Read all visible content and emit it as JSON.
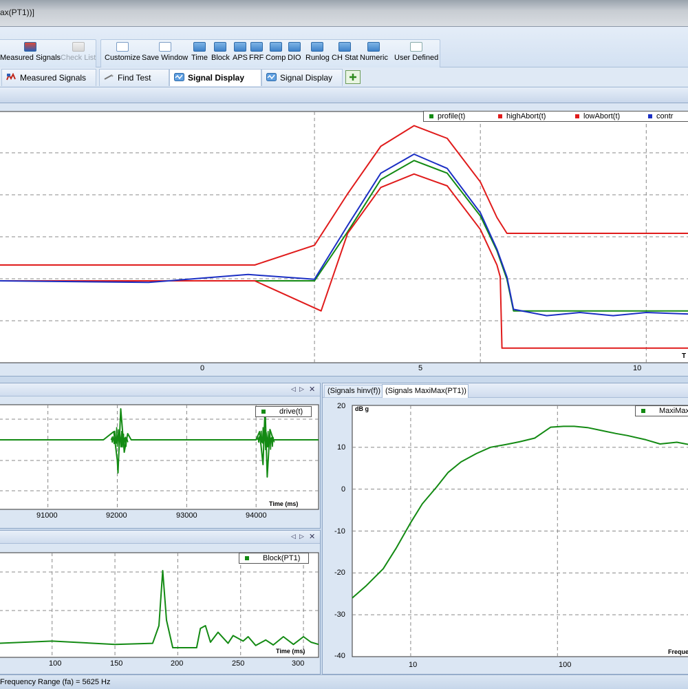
{
  "window": {
    "title": "ax(PT1))]"
  },
  "toolbar": {
    "buttons": [
      {
        "label": "Measured Signals",
        "icon": "measured-signals-icon"
      },
      {
        "label": "Check List",
        "icon": "check-list-icon",
        "disabled": true
      },
      {
        "label": "Customize",
        "icon": "customize-icon"
      },
      {
        "label": "Save Window",
        "icon": "save-window-icon"
      },
      {
        "label": "Time",
        "icon": "time-icon"
      },
      {
        "label": "Block",
        "icon": "block-icon"
      },
      {
        "label": "APS",
        "icon": "aps-icon"
      },
      {
        "label": "FRF",
        "icon": "frf-icon"
      },
      {
        "label": "Comp",
        "icon": "comp-icon"
      },
      {
        "label": "DIO",
        "icon": "dio-icon"
      },
      {
        "label": "Runlog",
        "icon": "runlog-icon"
      },
      {
        "label": "CH Stat",
        "icon": "ch-stat-icon"
      },
      {
        "label": "Numeric",
        "icon": "numeric-icon"
      },
      {
        "label": "User Defined",
        "icon": "user-defined-icon"
      }
    ]
  },
  "tabs": [
    {
      "label": "Measured Signals",
      "active": false
    },
    {
      "label": "Find Test",
      "active": false
    },
    {
      "label": "Signal Display",
      "active": true
    },
    {
      "label": "Signal Display",
      "active": false
    }
  ],
  "colors": {
    "green": "#138a13",
    "red": "#e01b1b",
    "blue": "#1b2fc4"
  },
  "top_chart": {
    "legend": [
      "profile(t)",
      "highAbort(t)",
      "lowAbort(t)",
      "contr"
    ],
    "x_ticks": [
      "0",
      "5",
      "10"
    ],
    "x_label": "T"
  },
  "drive_chart": {
    "legend": "drive(t)",
    "x_ticks": [
      "91000",
      "92000",
      "93000",
      "94000"
    ],
    "x_label": "Time (ms)"
  },
  "block_chart": {
    "legend": "Block(PT1)",
    "x_ticks": [
      "100",
      "150",
      "200",
      "250",
      "300"
    ],
    "x_label": "Time (ms)"
  },
  "maximax_panel": {
    "tabs": [
      "(Signals hinv(f))",
      "(Signals MaxiMax(PT1))"
    ],
    "legend": "MaxiMax",
    "y_unit": "dB g",
    "y_ticks": [
      "20",
      "10",
      "0",
      "-10",
      "-20",
      "-30",
      "-40"
    ],
    "x_ticks": [
      "10",
      "100"
    ],
    "x_label": "Freque"
  },
  "status": {
    "text": "Frequency Range (fa) = 5625 Hz"
  },
  "chart_data": [
    {
      "type": "line",
      "title": "",
      "xlabel": "T",
      "ylabel": "",
      "xlim": [
        -9.5,
        11.3
      ],
      "legend_position": "top-right",
      "grid": true,
      "series": [
        {
          "name": "profile(t)",
          "color": "#138a13",
          "x": [
            -9.5,
            -5,
            -2,
            0,
            1,
            2,
            3,
            4,
            5,
            5.5,
            5.8,
            6,
            7,
            8,
            9,
            10,
            11.3
          ],
          "y": [
            0,
            0,
            0,
            0,
            0.62,
            1.28,
            1.52,
            1.36,
            0.82,
            0.38,
            0.02,
            -0.38,
            -0.38,
            -0.38,
            -0.38,
            -0.38,
            -0.38
          ]
        },
        {
          "name": "highAbort(t)",
          "color": "#e01b1b",
          "x": [
            -9.5,
            -1.8,
            0,
            1,
            2,
            3,
            4,
            5,
            5.5,
            5.8,
            6,
            11.3
          ],
          "y": [
            0.2,
            0.2,
            0.45,
            1.1,
            1.7,
            1.96,
            1.8,
            1.25,
            0.8,
            0.6,
            0.6,
            0.6
          ]
        },
        {
          "name": "lowAbort(t)",
          "color": "#e01b1b",
          "x": [
            -9.5,
            -1.8,
            0.2,
            1,
            2,
            3,
            4,
            5,
            5.5,
            5.6,
            5.65,
            11.3
          ],
          "y": [
            0,
            0,
            -0.38,
            0.6,
            1.18,
            1.35,
            1.2,
            0.65,
            0.2,
            0.05,
            -0.85,
            -0.85
          ]
        },
        {
          "name": "contr",
          "color": "#1b2fc4",
          "x": [
            -9.5,
            -5,
            -2,
            0,
            1,
            2,
            3,
            4,
            5,
            5.5,
            5.8,
            6,
            7,
            8,
            9,
            10,
            11.3
          ],
          "y": [
            0,
            -0.02,
            0.08,
            0.02,
            0.7,
            1.36,
            1.6,
            1.42,
            0.86,
            0.4,
            0.05,
            -0.36,
            -0.44,
            -0.4,
            -0.44,
            -0.4,
            -0.42
          ]
        }
      ]
    },
    {
      "type": "line",
      "title": "",
      "xlabel": "Time (ms)",
      "ylabel": "",
      "xlim": [
        90300,
        94900
      ],
      "legend_position": "top-right",
      "grid": true,
      "series": [
        {
          "name": "drive(t)",
          "color": "#138a13",
          "x": [
            90300,
            91800,
            91950,
            92000,
            92010,
            92050,
            92100,
            92150,
            92200,
            94000,
            94050,
            94100,
            94130,
            94160,
            94200,
            94250,
            94900
          ],
          "y": [
            0,
            0,
            0.4,
            -1.0,
            -1.6,
            1.5,
            -0.6,
            0.3,
            0,
            0,
            0.4,
            -1.2,
            1.6,
            -1.8,
            0.5,
            0,
            0
          ]
        }
      ]
    },
    {
      "type": "line",
      "title": "",
      "xlabel": "Time (ms)",
      "ylabel": "",
      "xlim": [
        58,
        312
      ],
      "legend_position": "top-right",
      "grid": true,
      "series": [
        {
          "name": "Block(PT1)",
          "color": "#138a13",
          "x": [
            58,
            100,
            150,
            180,
            185,
            188,
            191,
            196,
            215,
            218,
            222,
            226,
            232,
            236,
            240,
            244,
            252,
            256,
            262,
            270,
            276,
            284,
            292,
            300,
            306,
            312
          ],
          "y": [
            0.08,
            0.12,
            0.06,
            0.08,
            0.4,
            1.4,
            0.5,
            0.0,
            0.0,
            0.35,
            0.4,
            0.1,
            0.28,
            0.18,
            0.08,
            0.22,
            0.12,
            0.2,
            0.04,
            0.14,
            0.05,
            0.2,
            0.06,
            0.2,
            0.1,
            0.06
          ]
        }
      ]
    },
    {
      "type": "line",
      "title": "",
      "xlabel": "Freque",
      "ylabel": "dB g",
      "x_scale": "log",
      "xlim": [
        4,
        800
      ],
      "ylim": [
        -40,
        20
      ],
      "legend_position": "top-right",
      "grid": true,
      "series": [
        {
          "name": "MaxiMax",
          "color": "#138a13",
          "x": [
            4,
            5,
            6.5,
            8,
            10,
            12,
            15,
            18,
            22,
            28,
            35,
            45,
            55,
            70,
            90,
            110,
            130,
            160,
            200,
            250,
            300,
            400,
            500,
            650,
            800
          ],
          "y": [
            -26,
            -23,
            -19,
            -14,
            -8,
            -3.5,
            0.5,
            4,
            6.5,
            8.5,
            10,
            10.7,
            11.3,
            12.2,
            14.8,
            15,
            15,
            14.7,
            14,
            13.3,
            12.8,
            11.8,
            10.8,
            11.2,
            10.6
          ]
        }
      ]
    }
  ]
}
